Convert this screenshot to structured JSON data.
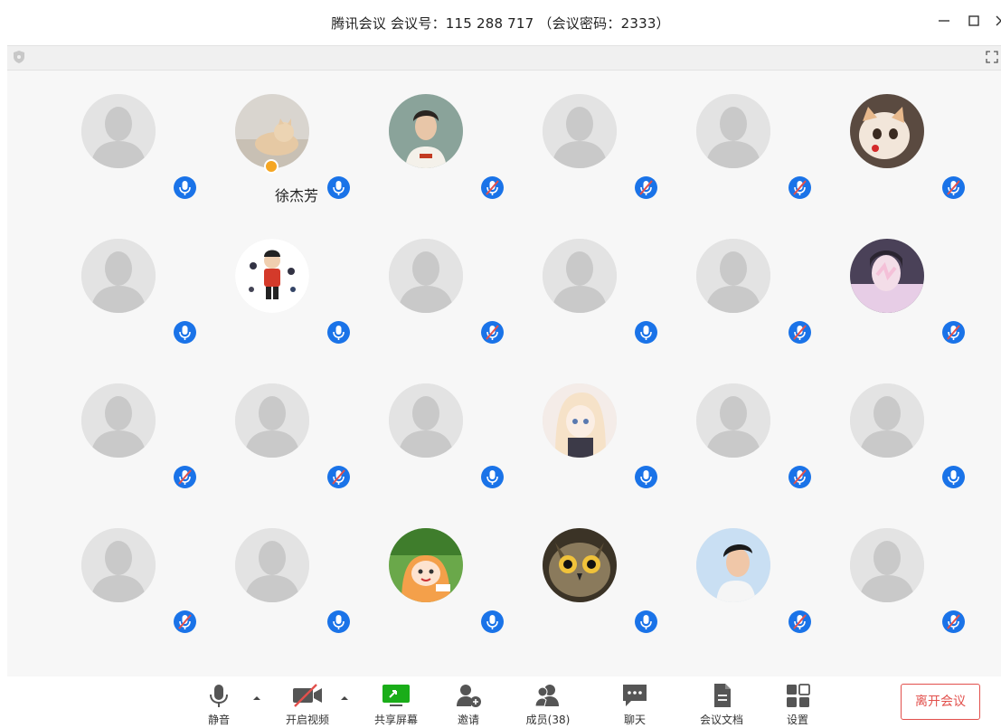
{
  "window": {
    "title": "腾讯会议 会议号：115 288 717 （会议密码：2333）"
  },
  "participants": [
    {
      "name": "",
      "avatar": "default",
      "mic": "on"
    },
    {
      "name": "徐杰芳",
      "avatar": "photo-cat",
      "mic": "on",
      "host": true
    },
    {
      "name": "",
      "avatar": "photo-boy",
      "mic": "muted"
    },
    {
      "name": "",
      "avatar": "default",
      "mic": "muted"
    },
    {
      "name": "",
      "avatar": "default",
      "mic": "muted"
    },
    {
      "name": "",
      "avatar": "photo-kitten",
      "mic": "muted"
    },
    {
      "name": "",
      "avatar": "default",
      "mic": "on"
    },
    {
      "name": "",
      "avatar": "photo-cartoon",
      "mic": "on"
    },
    {
      "name": "",
      "avatar": "default",
      "mic": "muted"
    },
    {
      "name": "",
      "avatar": "default",
      "mic": "on"
    },
    {
      "name": "",
      "avatar": "default",
      "mic": "muted"
    },
    {
      "name": "",
      "avatar": "photo-girl",
      "mic": "muted"
    },
    {
      "name": "",
      "avatar": "default",
      "mic": "muted"
    },
    {
      "name": "",
      "avatar": "default",
      "mic": "muted"
    },
    {
      "name": "",
      "avatar": "default",
      "mic": "on"
    },
    {
      "name": "",
      "avatar": "photo-anime",
      "mic": "on"
    },
    {
      "name": "",
      "avatar": "default",
      "mic": "muted"
    },
    {
      "name": "",
      "avatar": "default",
      "mic": "none"
    },
    {
      "name": "",
      "avatar": "default",
      "mic": "muted"
    },
    {
      "name": "",
      "avatar": "default",
      "mic": "on"
    },
    {
      "name": "",
      "avatar": "photo-umaru",
      "mic": "on"
    },
    {
      "name": "",
      "avatar": "photo-owl",
      "mic": "none"
    },
    {
      "name": "",
      "avatar": "photo-man",
      "mic": "muted"
    },
    {
      "name": "",
      "avatar": "default",
      "mic": "muted"
    }
  ],
  "toolbar": {
    "mute_label": "静音",
    "video_label": "开启视频",
    "share_label": "共享屏幕",
    "invite_label": "邀请",
    "members_label": "成员(38)",
    "chat_label": "聊天",
    "docs_label": "会议文档",
    "settings_label": "设置",
    "leave_label": "离开会议"
  },
  "colors": {
    "accent": "#1a73e8",
    "share_green": "#1aad19",
    "leave_red": "#e2504c"
  },
  "icons": [
    "minimize-icon",
    "maximize-icon",
    "close-icon",
    "shield-icon",
    "fullscreen-icon",
    "microphone-icon",
    "video-off-icon",
    "share-screen-icon",
    "invite-icon",
    "members-icon",
    "chat-icon",
    "document-icon",
    "settings-icon"
  ]
}
